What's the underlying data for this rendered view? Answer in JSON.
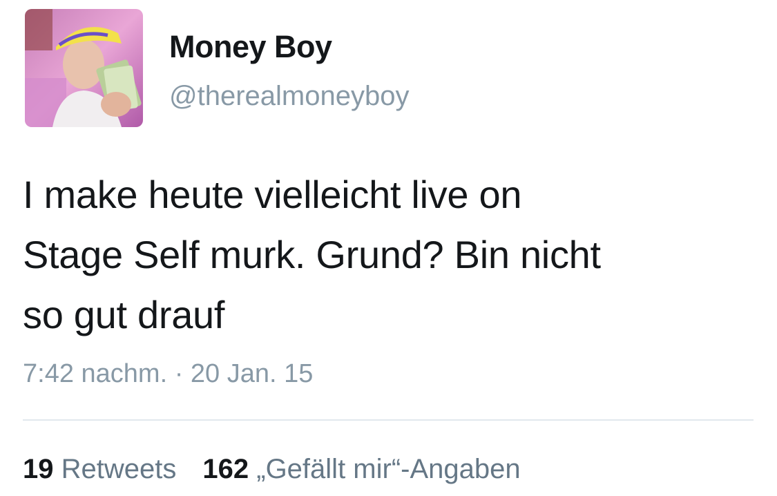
{
  "user": {
    "name": "Money Boy",
    "handle": "@therealmoneyboy",
    "avatar_icon": "profile-photo"
  },
  "tweet": {
    "lines": [
      "I make heute vielleicht live on",
      "Stage Self murk. Grund? Bin nicht",
      "so gut drauf"
    ],
    "time": "7:42 nachm.",
    "separator": "·",
    "date": "20 Jan. 15"
  },
  "stats": {
    "retweets_count": "19",
    "retweets_label": "Retweets",
    "likes_count": "162",
    "likes_label": "„Gefällt mir“-Angaben"
  },
  "colors": {
    "text": "#14171a",
    "muted": "#8899a6",
    "divider": "#e1e8ed"
  }
}
